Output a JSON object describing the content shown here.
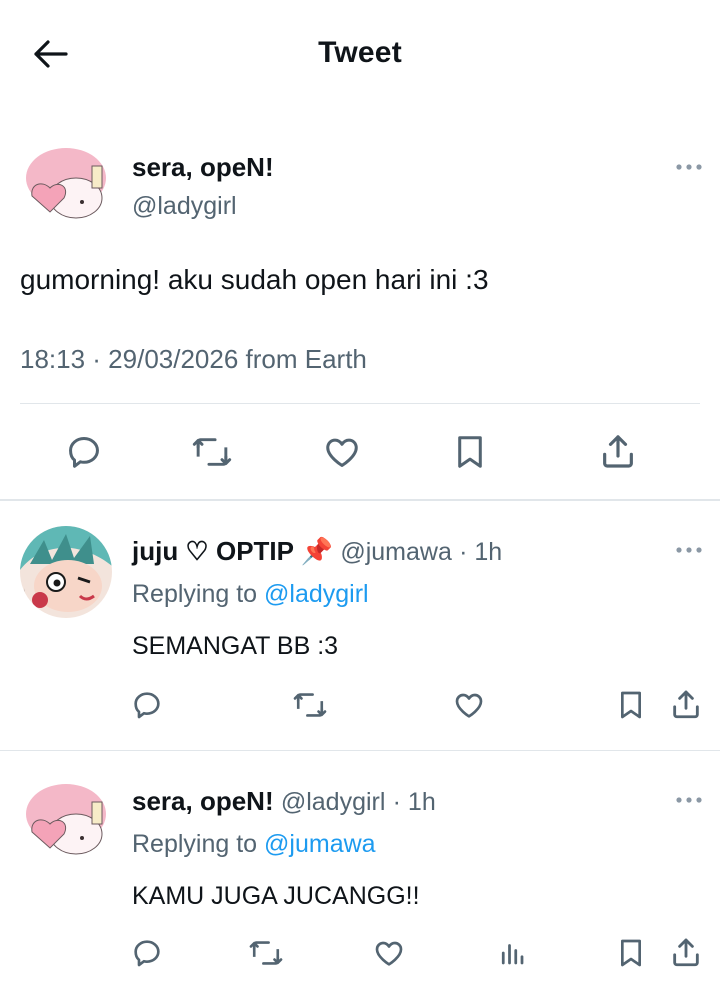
{
  "header": {
    "title": "Tweet"
  },
  "main_tweet": {
    "display_name": "sera, opeN!",
    "handle": "@ladygirl",
    "text": "gumorning! aku sudah open hari ini :3",
    "meta": "18:13 · 29/03/2026 from Earth"
  },
  "replies": [
    {
      "display_name": "juju ♡ OPTIP 📌",
      "handle": "@jumawa",
      "time": "· 1h",
      "replying_prefix": "Replying to",
      "replying_to": "@ladygirl",
      "text": "SEMANGAT BB :3"
    },
    {
      "display_name": "sera, opeN!",
      "handle": "@ladygirl",
      "time": "· 1h",
      "replying_prefix": "Replying to",
      "replying_to": "@jumawa",
      "text": "KAMU JUGA JUCANGG!!"
    }
  ],
  "colors": {
    "link": "#1d9bf0",
    "secondary_text": "#536471",
    "divider": "#e1e6ea",
    "icon": "#536471"
  },
  "icons": [
    "back-arrow-icon",
    "more-icon",
    "reply-icon",
    "retweet-icon",
    "like-icon",
    "bookmark-icon",
    "share-icon",
    "views-icon"
  ]
}
